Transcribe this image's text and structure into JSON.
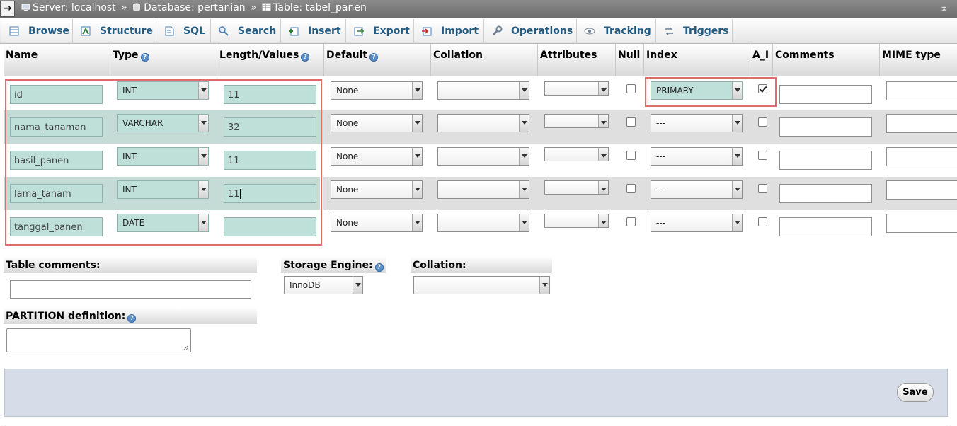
{
  "breadcrumb": {
    "arrow": "→",
    "server": "Server: localhost",
    "database": "Database: pertanian",
    "table": "Table: tabel_panen",
    "separator": "»",
    "collapse": "⌅"
  },
  "tabs": [
    {
      "label": "Browse",
      "icon": "browse-icon"
    },
    {
      "label": "Structure",
      "icon": "structure-icon"
    },
    {
      "label": "SQL",
      "icon": "sql-icon"
    },
    {
      "label": "Search",
      "icon": "search-icon"
    },
    {
      "label": "Insert",
      "icon": "insert-icon"
    },
    {
      "label": "Export",
      "icon": "export-icon"
    },
    {
      "label": "Import",
      "icon": "import-icon"
    },
    {
      "label": "Operations",
      "icon": "wrench-icon"
    },
    {
      "label": "Tracking",
      "icon": "eye-icon"
    },
    {
      "label": "Triggers",
      "icon": "triggers-icon"
    }
  ],
  "columns": {
    "name": "Name",
    "type": "Type",
    "length": "Length/Values",
    "default": "Default",
    "collation": "Collation",
    "attributes": "Attributes",
    "null": "Null",
    "index": "Index",
    "ai": "A_I",
    "comments": "Comments",
    "mime": "MIME type"
  },
  "fields": [
    {
      "name": "id",
      "type": "INT",
      "length": "11",
      "default": "None",
      "index": "PRIMARY",
      "ai": true,
      "null": false
    },
    {
      "name": "nama_tanaman",
      "type": "VARCHAR",
      "length": "32",
      "default": "None",
      "index": "---",
      "ai": false,
      "null": false
    },
    {
      "name": "hasil_panen",
      "type": "INT",
      "length": "11",
      "default": "None",
      "index": "---",
      "ai": false,
      "null": false
    },
    {
      "name": "lama_tanam",
      "type": "INT",
      "length": "11",
      "default": "None",
      "index": "---",
      "ai": false,
      "null": false
    },
    {
      "name": "tanggal_panen",
      "type": "DATE",
      "length": "",
      "default": "None",
      "index": "---",
      "ai": false,
      "null": false
    }
  ],
  "table_options": {
    "comments_label": "Table comments:",
    "storage_engine_label": "Storage Engine:",
    "storage_engine_value": "InnoDB",
    "collation_label": "Collation:",
    "partition_label": "PARTITION definition:"
  },
  "help_glyph": "?",
  "save_label": "Save",
  "colors": {
    "highlight_border": "#e06b6b",
    "highlight_fill": "#bfe0d9",
    "tab_text": "#235a81"
  }
}
